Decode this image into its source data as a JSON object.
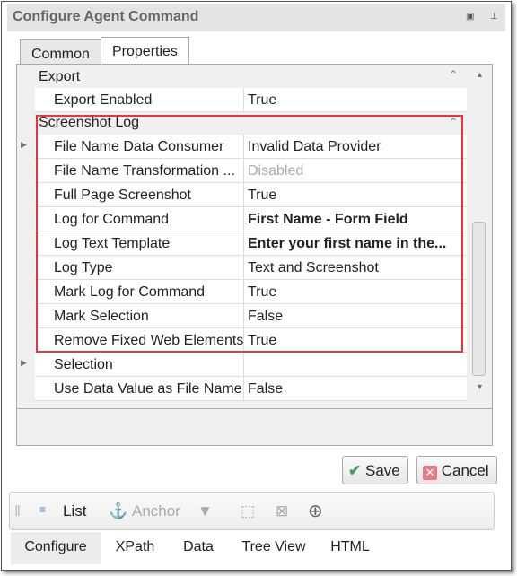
{
  "window": {
    "title": "Configure Agent Command",
    "restore_icon": "restore-icon",
    "pin_icon": "pin-icon"
  },
  "tabs": [
    {
      "label": "Common",
      "active": false
    },
    {
      "label": "Properties",
      "active": true
    }
  ],
  "grid": {
    "categories": [
      {
        "label": "Export"
      },
      {
        "label": "Screenshot Log"
      }
    ],
    "export_rows": [
      {
        "name": "Export Enabled",
        "value": "True"
      }
    ],
    "screenshot_rows": [
      {
        "name": "File Name Data Consumer",
        "value": "Invalid Data Provider",
        "expandable": true
      },
      {
        "name": "File Name Transformation ...",
        "value": "Disabled",
        "disabled": true
      },
      {
        "name": "Full Page Screenshot",
        "value": "True"
      },
      {
        "name": "Log for Command",
        "value": "First Name - Form Field",
        "bold": true
      },
      {
        "name": "Log Text Template",
        "value": "Enter your first name in the...",
        "bold": true
      },
      {
        "name": "Log Type",
        "value": "Text and Screenshot"
      },
      {
        "name": "Mark Log for Command",
        "value": "True"
      },
      {
        "name": "Mark Selection",
        "value": "False"
      },
      {
        "name": "Remove Fixed Web Elements",
        "value": "True"
      }
    ],
    "other_rows": [
      {
        "name": "Selection",
        "value": "",
        "expandable": true
      },
      {
        "name": "Use Data Value as File Name",
        "value": "False"
      }
    ],
    "highlight_color": "#e8343a"
  },
  "buttons": {
    "save": "Save",
    "cancel": "Cancel"
  },
  "toolbar": {
    "list": "List",
    "anchor": "Anchor"
  },
  "bottom_tabs": [
    {
      "label": "Configure",
      "active": true
    },
    {
      "label": "XPath"
    },
    {
      "label": "Data"
    },
    {
      "label": "Tree View"
    },
    {
      "label": "HTML"
    }
  ]
}
